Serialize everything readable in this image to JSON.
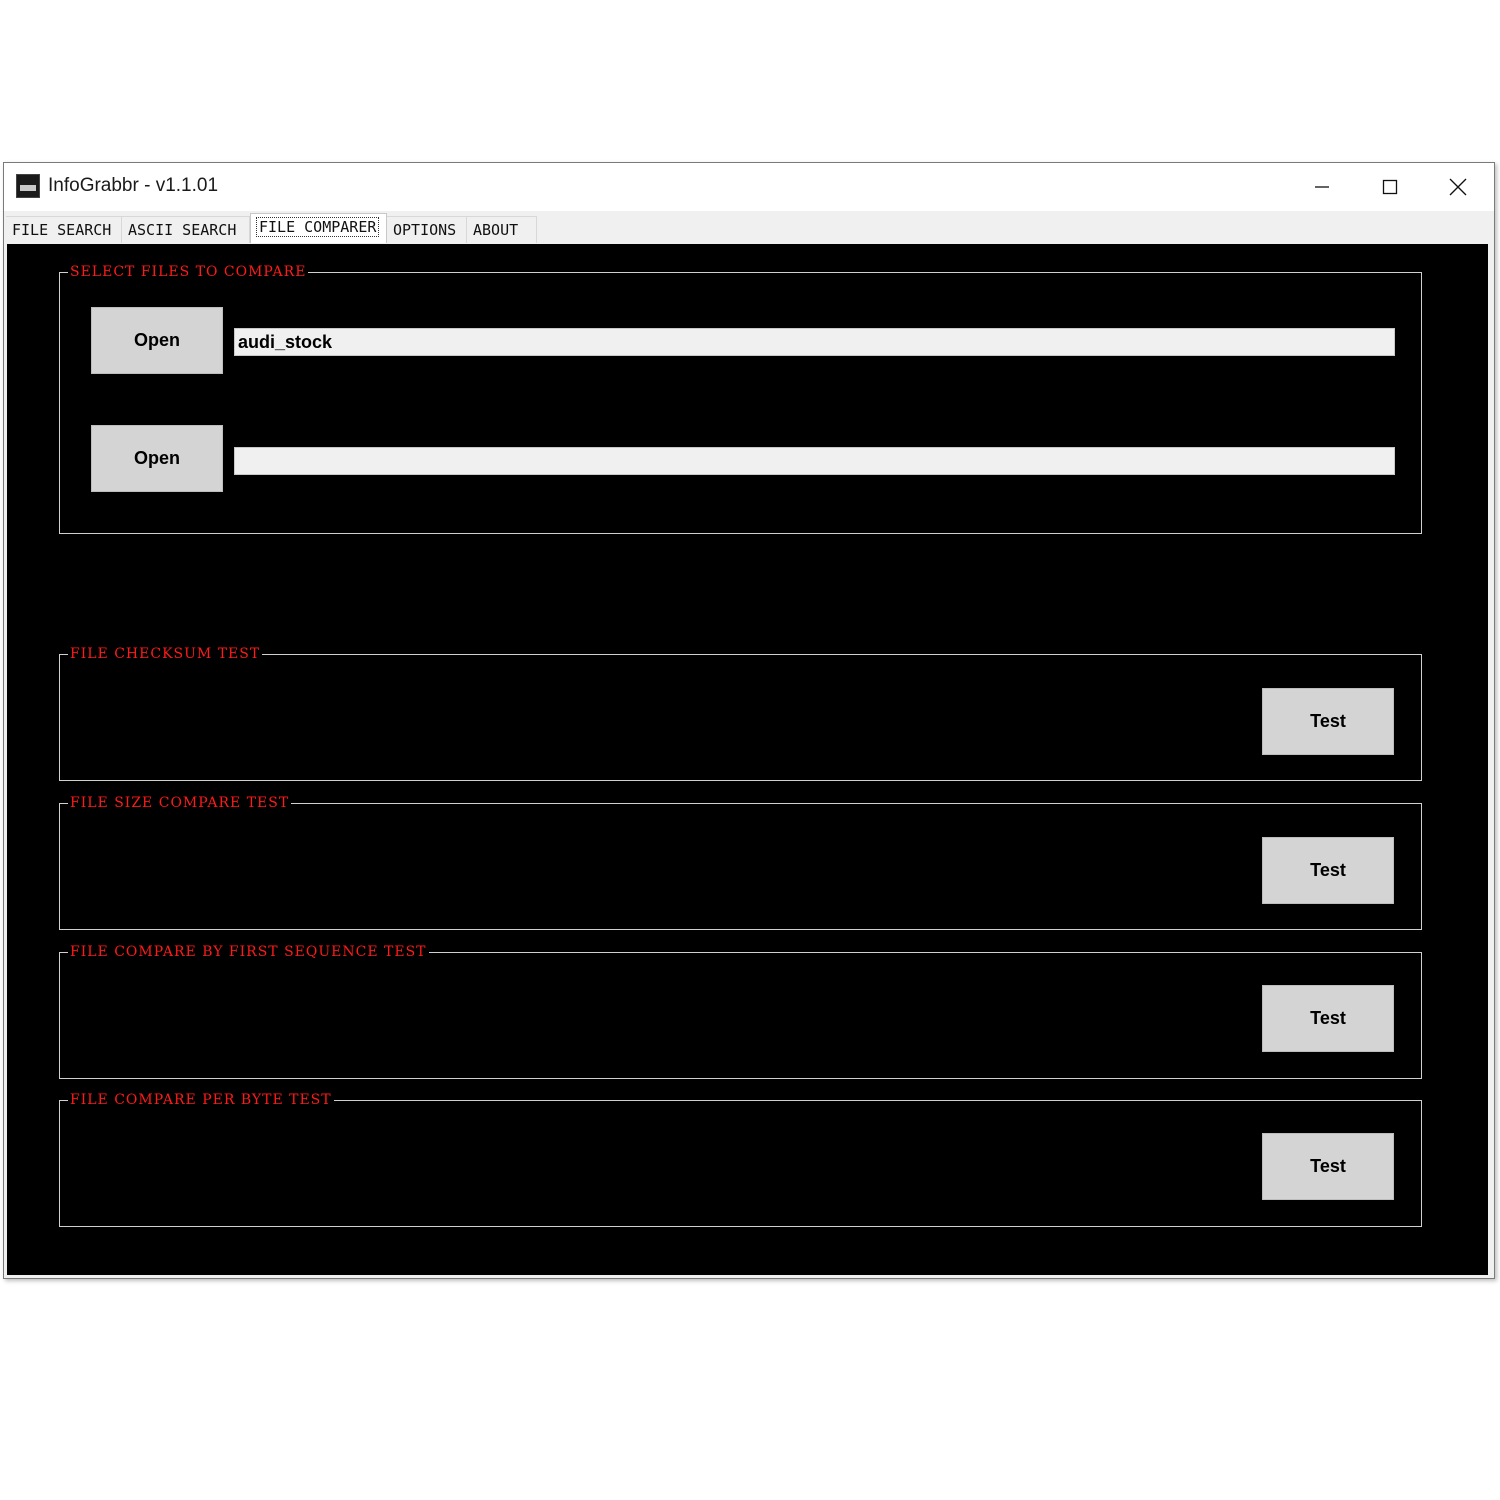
{
  "window": {
    "title": "InfoGrabbr - v1.1.01",
    "icon": "app-icon",
    "controls": {
      "minimize": "minimize-icon",
      "maximize": "maximize-icon",
      "close": "close-icon"
    }
  },
  "tabs": [
    {
      "label": "FILE SEARCH"
    },
    {
      "label": "ASCII SEARCH"
    },
    {
      "label": "FILE COMPARER",
      "selected": true
    },
    {
      "label": "OPTIONS"
    },
    {
      "label": "ABOUT"
    }
  ],
  "select_files": {
    "title": "SELECT FILES TO COMPARE",
    "file1": {
      "button": "Open",
      "value": "audi_stock"
    },
    "file2": {
      "button": "Open",
      "value": ""
    }
  },
  "tests": [
    {
      "title": "FILE CHECKSUM TEST",
      "button": "Test"
    },
    {
      "title": "FILE SIZE COMPARE TEST",
      "button": "Test"
    },
    {
      "title": "FILE COMPARE BY FIRST SEQUENCE TEST",
      "button": "Test"
    },
    {
      "title": "FILE COMPARE PER BYTE TEST",
      "button": "Test"
    }
  ],
  "colors": {
    "content_background": "#000000",
    "group_title": "#ff1a1a",
    "button_face": "#d4d4d4"
  }
}
